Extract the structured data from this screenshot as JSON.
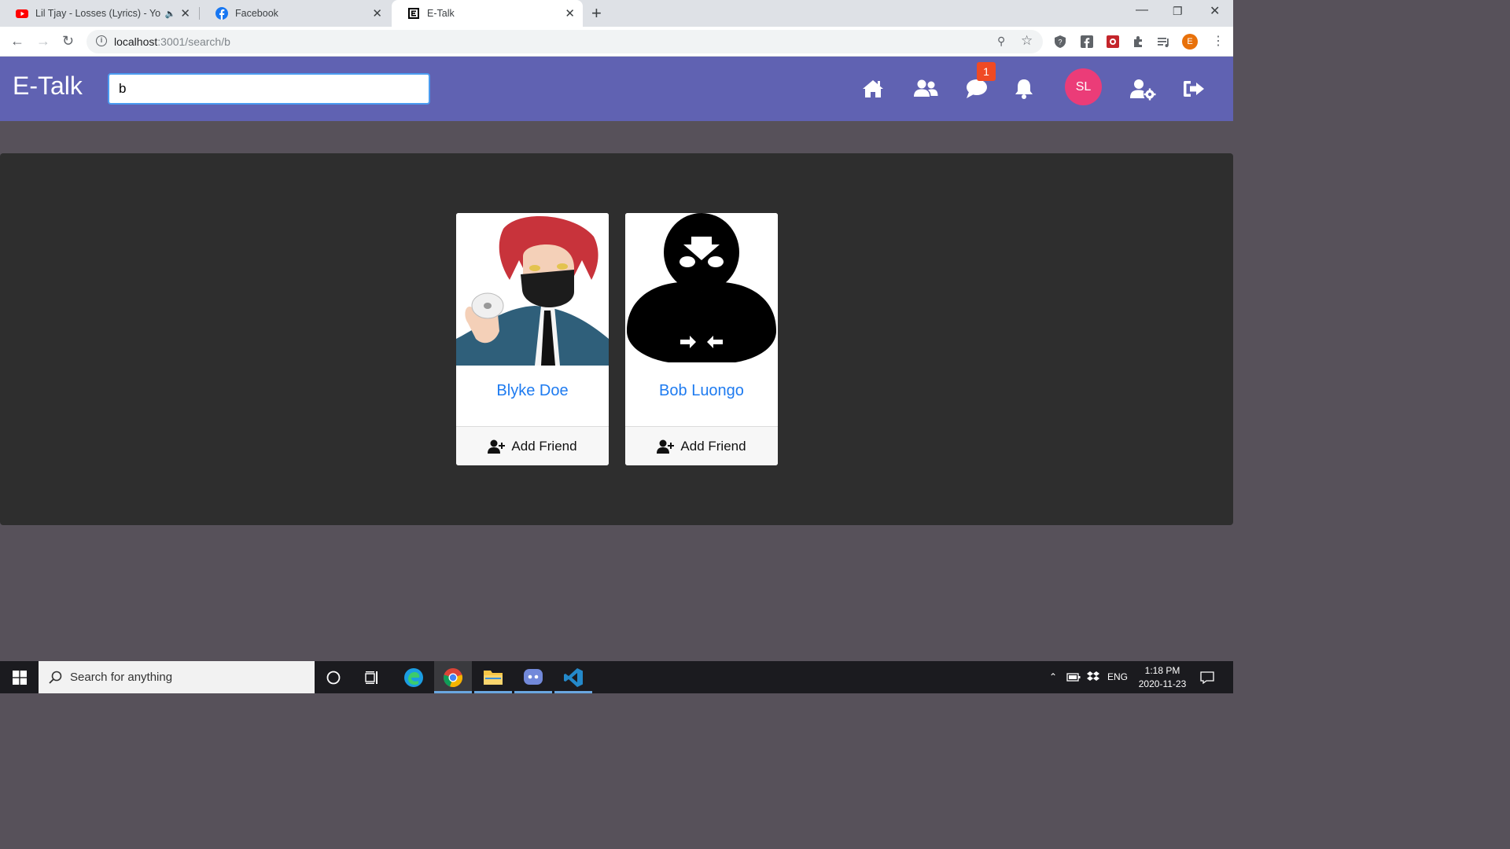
{
  "browser": {
    "tabs": [
      {
        "title": "Lil Tjay - Losses (Lyrics) - You",
        "icon": "youtube-icon"
      },
      {
        "title": "Facebook",
        "icon": "facebook-icon"
      },
      {
        "title": "E-Talk",
        "icon": "etalk-icon"
      }
    ],
    "url_host": "localhost",
    "url_path": ":3001/search/b",
    "profile_initial": "E"
  },
  "app": {
    "brand": "E-Talk",
    "search_value": "b",
    "messages_badge": "1",
    "user_initials": "SL",
    "nav_icons": [
      "home-icon",
      "friends-icon",
      "messages-icon",
      "notifications-icon",
      "account-settings-icon",
      "logout-icon"
    ],
    "accent": "#6062b2"
  },
  "results": [
    {
      "name": "Blyke Doe",
      "action": "Add Friend"
    },
    {
      "name": "Bob Luongo",
      "action": "Add Friend"
    }
  ],
  "taskbar": {
    "search_placeholder": "Search for anything",
    "language": "ENG",
    "time": "1:18 PM",
    "date": "2020-11-23"
  }
}
